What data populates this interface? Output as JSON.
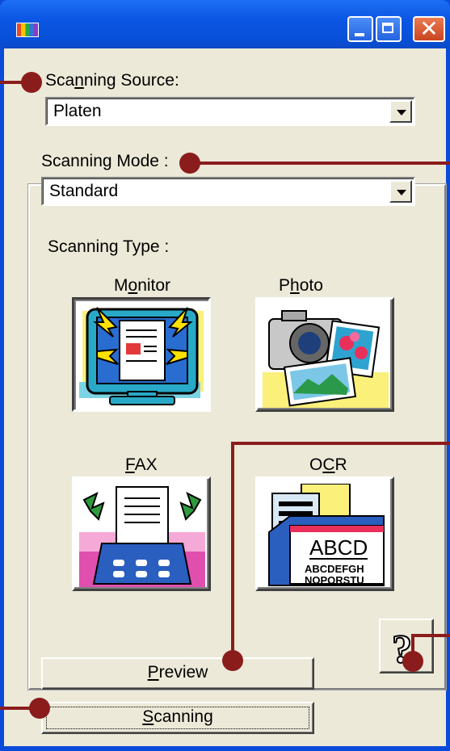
{
  "window": {
    "title": ""
  },
  "titlebar": {
    "app_icon": "app-color-icon",
    "minimize_icon": "minimize-icon",
    "maximize_icon": "maximize-icon",
    "close_icon": "close-icon",
    "close_glyph": "✕"
  },
  "source": {
    "label_pre": "Sca",
    "label_ul": "n",
    "label_post": "ning Source:",
    "value": "Platen"
  },
  "mode": {
    "label": "Scanning Mode :",
    "value": "Standard"
  },
  "type": {
    "label": "Scanning Type :",
    "buttons": [
      {
        "label_pre": "M",
        "label_ul": "o",
        "label_post": "nitor",
        "icon": "monitor-icon",
        "pressed": true
      },
      {
        "label_pre": "P",
        "label_ul": "h",
        "label_post": "oto",
        "icon": "camera-photo-icon",
        "pressed": false
      },
      {
        "label_pre": "",
        "label_ul": "F",
        "label_post": "AX",
        "icon": "fax-icon",
        "pressed": false
      },
      {
        "label_pre": "O",
        "label_ul": "C",
        "label_post": "R",
        "icon": "ocr-document-icon",
        "pressed": false
      }
    ],
    "ocr_text_line1": "ABCD",
    "ocr_text_line2": "ABCDEFGH",
    "ocr_text_line3": "NOPQRSTU"
  },
  "actions": {
    "preview_ul": "P",
    "preview_post": "review",
    "scanning_ul": "S",
    "scanning_post": "canning",
    "help_glyph": "?"
  },
  "colors": {
    "titlebar": "#0b56e4",
    "face": "#ece9d8",
    "callout": "#8b1c1c",
    "background": "#dbe8f5"
  }
}
